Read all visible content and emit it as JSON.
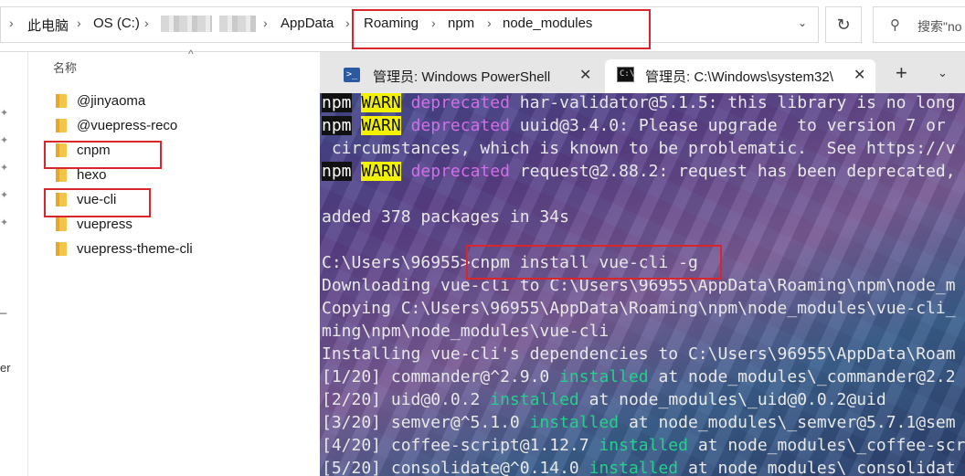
{
  "explorer": {
    "breadcrumbs": [
      "此电脑",
      "OS (C:)",
      "AppData",
      "Roaming",
      "npm",
      "node_modules"
    ],
    "search_placeholder": "搜索\"no",
    "column_header": "名称",
    "files": [
      "@jinyaoma",
      "@vuepress-reco",
      "cnpm",
      "hexo",
      "vue-cli",
      "vuepress",
      "vuepress-theme-cli"
    ],
    "nav_fragments": [
      "_",
      "er"
    ]
  },
  "terminal": {
    "tabs": [
      {
        "title": "管理员: Windows PowerShell",
        "icon": "powershell-icon"
      },
      {
        "title": "管理员: C:\\Windows\\system32\\",
        "icon": "cmd-icon"
      }
    ],
    "lines": [
      {
        "segs": [
          {
            "t": "npm",
            "c": "npm"
          },
          {
            "t": " "
          },
          {
            "t": "WARN",
            "c": "warn"
          },
          {
            "t": " "
          },
          {
            "t": "deprecated",
            "c": "dep"
          },
          {
            "t": " har-validator@5.1.5: this library is no long"
          }
        ]
      },
      {
        "segs": [
          {
            "t": "npm",
            "c": "npm"
          },
          {
            "t": " "
          },
          {
            "t": "WARN",
            "c": "warn"
          },
          {
            "t": " "
          },
          {
            "t": "deprecated",
            "c": "dep"
          },
          {
            "t": " uuid@3.4.0: Please upgrade  to version 7 or"
          }
        ]
      },
      {
        "segs": [
          {
            "t": " circumstances, which is known to be problematic.  See https://v"
          }
        ]
      },
      {
        "segs": [
          {
            "t": "npm",
            "c": "npm"
          },
          {
            "t": " "
          },
          {
            "t": "WARN",
            "c": "warn"
          },
          {
            "t": " "
          },
          {
            "t": "deprecated",
            "c": "dep"
          },
          {
            "t": " request@2.88.2: request has been deprecated,"
          }
        ]
      },
      {
        "segs": [
          {
            "t": ""
          }
        ]
      },
      {
        "segs": [
          {
            "t": "added 378 packages in 34s"
          }
        ]
      },
      {
        "segs": [
          {
            "t": ""
          }
        ]
      },
      {
        "segs": [
          {
            "t": "C:\\Users\\96955>cnpm install vue-cli -g"
          }
        ]
      },
      {
        "segs": [
          {
            "t": "Downloading vue-cli to C:\\Users\\96955\\AppData\\Roaming\\npm\\node_m"
          }
        ]
      },
      {
        "segs": [
          {
            "t": "Copying C:\\Users\\96955\\AppData\\Roaming\\npm\\node_modules\\vue-cli_"
          }
        ]
      },
      {
        "segs": [
          {
            "t": "ming\\npm\\node_modules\\vue-cli"
          }
        ]
      },
      {
        "segs": [
          {
            "t": "Installing vue-cli's dependencies to C:\\Users\\96955\\AppData\\Roam"
          }
        ]
      },
      {
        "segs": [
          {
            "t": "[1/20] commander@^2.9.0 "
          },
          {
            "t": "installed",
            "c": "ok"
          },
          {
            "t": " at node_modules\\_commander@2.2"
          }
        ]
      },
      {
        "segs": [
          {
            "t": "[2/20] uid@0.0.2 "
          },
          {
            "t": "installed",
            "c": "ok"
          },
          {
            "t": " at node_modules\\_uid@0.0.2@uid"
          }
        ]
      },
      {
        "segs": [
          {
            "t": "[3/20] semver@^5.1.0 "
          },
          {
            "t": "installed",
            "c": "ok"
          },
          {
            "t": " at node_modules\\_semver@5.7.1@sem"
          }
        ]
      },
      {
        "segs": [
          {
            "t": "[4/20] coffee-script@1.12.7 "
          },
          {
            "t": "installed",
            "c": "ok"
          },
          {
            "t": " at node_modules\\_coffee-scri"
          }
        ]
      },
      {
        "segs": [
          {
            "t": "[5/20] consolidate@^0.14.0 "
          },
          {
            "t": "installed",
            "c": "ok"
          },
          {
            "t": " at node_modules\\_consolidat"
          }
        ]
      }
    ]
  }
}
